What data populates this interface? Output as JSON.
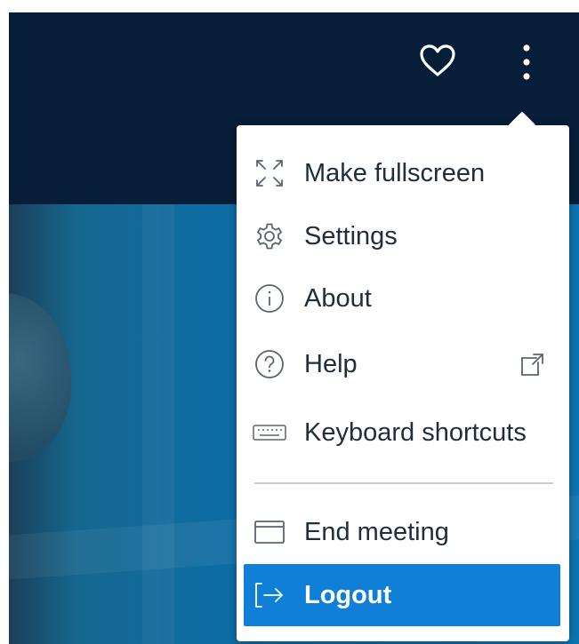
{
  "header": {
    "favorite_icon": "heart-icon",
    "more_icon": "vertical-ellipsis-icon"
  },
  "menu": {
    "items": [
      {
        "label": "Make fullscreen",
        "icon": "fullscreen-icon"
      },
      {
        "label": "Settings",
        "icon": "gear-icon"
      },
      {
        "label": "About",
        "icon": "info-icon"
      },
      {
        "label": "Help",
        "icon": "help-icon",
        "trailing_icon": "external-link-icon"
      },
      {
        "label": "Keyboard shortcuts",
        "icon": "keyboard-icon"
      }
    ],
    "secondary_items": [
      {
        "label": "End meeting",
        "icon": "window-icon"
      },
      {
        "label": "Logout",
        "icon": "logout-icon",
        "highlighted": true
      }
    ]
  },
  "colors": {
    "topbar": "#071e39",
    "video_background": "#0d6da6",
    "highlight": "#0f7fd8",
    "menu_text": "#1f2d3d"
  }
}
